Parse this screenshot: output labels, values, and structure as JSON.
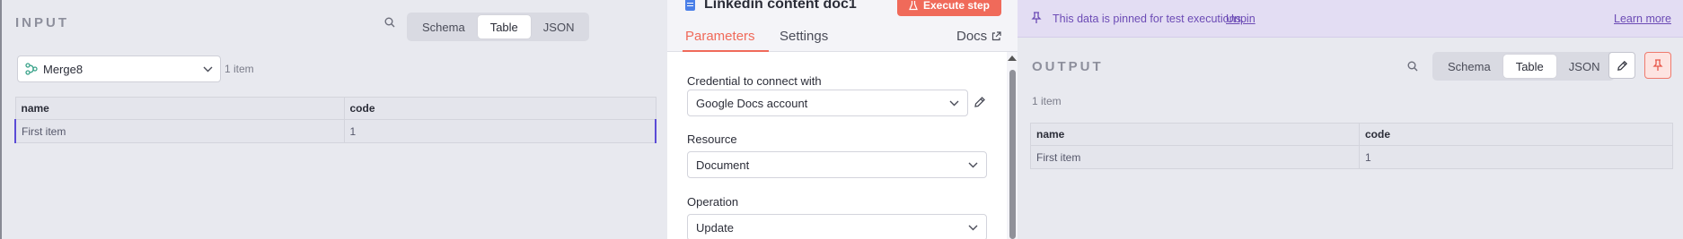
{
  "input": {
    "title": "INPUT",
    "view_modes": [
      "Schema",
      "Table",
      "JSON"
    ],
    "active_view": "Table",
    "node_select": {
      "value": "Merge8"
    },
    "items_count": "1 item",
    "table": {
      "columns": [
        "name",
        "code"
      ],
      "rows": [
        [
          "First item",
          "1"
        ]
      ]
    }
  },
  "params": {
    "node_title": "Linkedin content doc1",
    "execute_label": "Execute step",
    "tabs": [
      "Parameters",
      "Settings"
    ],
    "active_tab": "Parameters",
    "docs_label": "Docs",
    "fields": [
      {
        "label": "Credential to connect with",
        "value": "Google Docs account"
      },
      {
        "label": "Resource",
        "value": "Document"
      },
      {
        "label": "Operation",
        "value": "Update"
      }
    ]
  },
  "output": {
    "title": "OUTPUT",
    "banner_text": "This data is pinned for test executions.",
    "unpin_label": "Unpin",
    "learn_more_label": "Learn more",
    "view_modes": [
      "Schema",
      "Table",
      "JSON"
    ],
    "active_view": "Table",
    "items_count": "1 item",
    "table": {
      "columns": [
        "name",
        "code"
      ],
      "rows": [
        [
          "First item",
          "1"
        ]
      ]
    }
  },
  "colors": {
    "accent": "#f06a5a",
    "pinned_text": "#6c4bb5",
    "pinned_bg": "#e3ddf3",
    "selection": "#5b4bd6"
  },
  "icons": [
    "search-icon",
    "node-branch-icon",
    "chevron-down-icon",
    "doc-icon",
    "flask-icon",
    "external-link-icon",
    "pencil-icon",
    "pin-icon"
  ]
}
